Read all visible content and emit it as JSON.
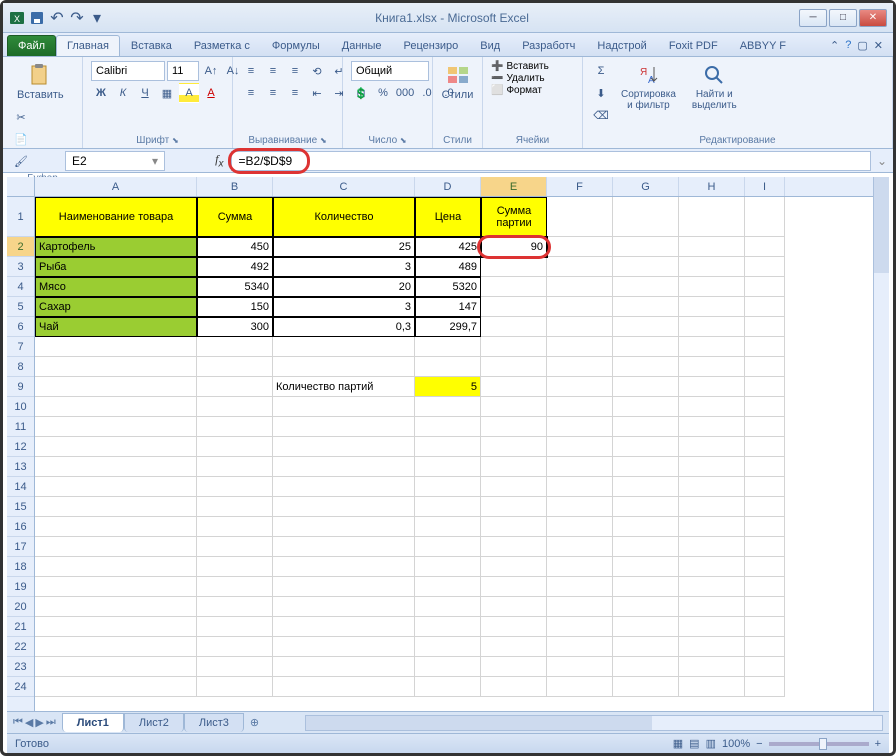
{
  "window": {
    "title": "Книга1.xlsx - Microsoft Excel"
  },
  "tabs": {
    "file": "Файл",
    "items": [
      "Главная",
      "Вставка",
      "Разметка с",
      "Формулы",
      "Данные",
      "Рецензиро",
      "Вид",
      "Разработч",
      "Надстрой",
      "Foxit PDF",
      "ABBYY F"
    ],
    "active": 0
  },
  "ribbon": {
    "clipboard": {
      "paste": "Вставить",
      "label": "Буфер обмена"
    },
    "font": {
      "name": "Calibri",
      "size": "11",
      "label": "Шрифт"
    },
    "align": {
      "label": "Выравнивание"
    },
    "number": {
      "format": "Общий",
      "label": "Число"
    },
    "styles": {
      "label": "Стили",
      "btn": "Стили"
    },
    "cells": {
      "insert": "Вставить",
      "delete": "Удалить",
      "format": "Формат",
      "label": "Ячейки"
    },
    "editing": {
      "sort": "Сортировка\nи фильтр",
      "find": "Найти и\nвыделить",
      "label": "Редактирование"
    }
  },
  "namebox": "E2",
  "formula": "=B2/$D$9",
  "columns": [
    "A",
    "B",
    "C",
    "D",
    "E",
    "F",
    "G",
    "H",
    "I"
  ],
  "headers": {
    "A": "Наименование товара",
    "B": "Сумма",
    "C": "Количество",
    "D": "Цена",
    "E": "Сумма партии"
  },
  "rows": [
    {
      "A": "Картофель",
      "B": "450",
      "C": "25",
      "D": "425",
      "E": "90"
    },
    {
      "A": "Рыба",
      "B": "492",
      "C": "3",
      "D": "489",
      "E": ""
    },
    {
      "A": "Мясо",
      "B": "5340",
      "C": "20",
      "D": "5320",
      "E": ""
    },
    {
      "A": "Сахар",
      "B": "150",
      "C": "3",
      "D": "147",
      "E": ""
    },
    {
      "A": "Чай",
      "B": "300",
      "C": "0,3",
      "D": "299,7",
      "E": ""
    }
  ],
  "batch": {
    "label": "Количество партий",
    "value": "5"
  },
  "sheets": [
    "Лист1",
    "Лист2",
    "Лист3"
  ],
  "status": {
    "ready": "Готово",
    "zoom": "100%"
  },
  "chart_data": null
}
